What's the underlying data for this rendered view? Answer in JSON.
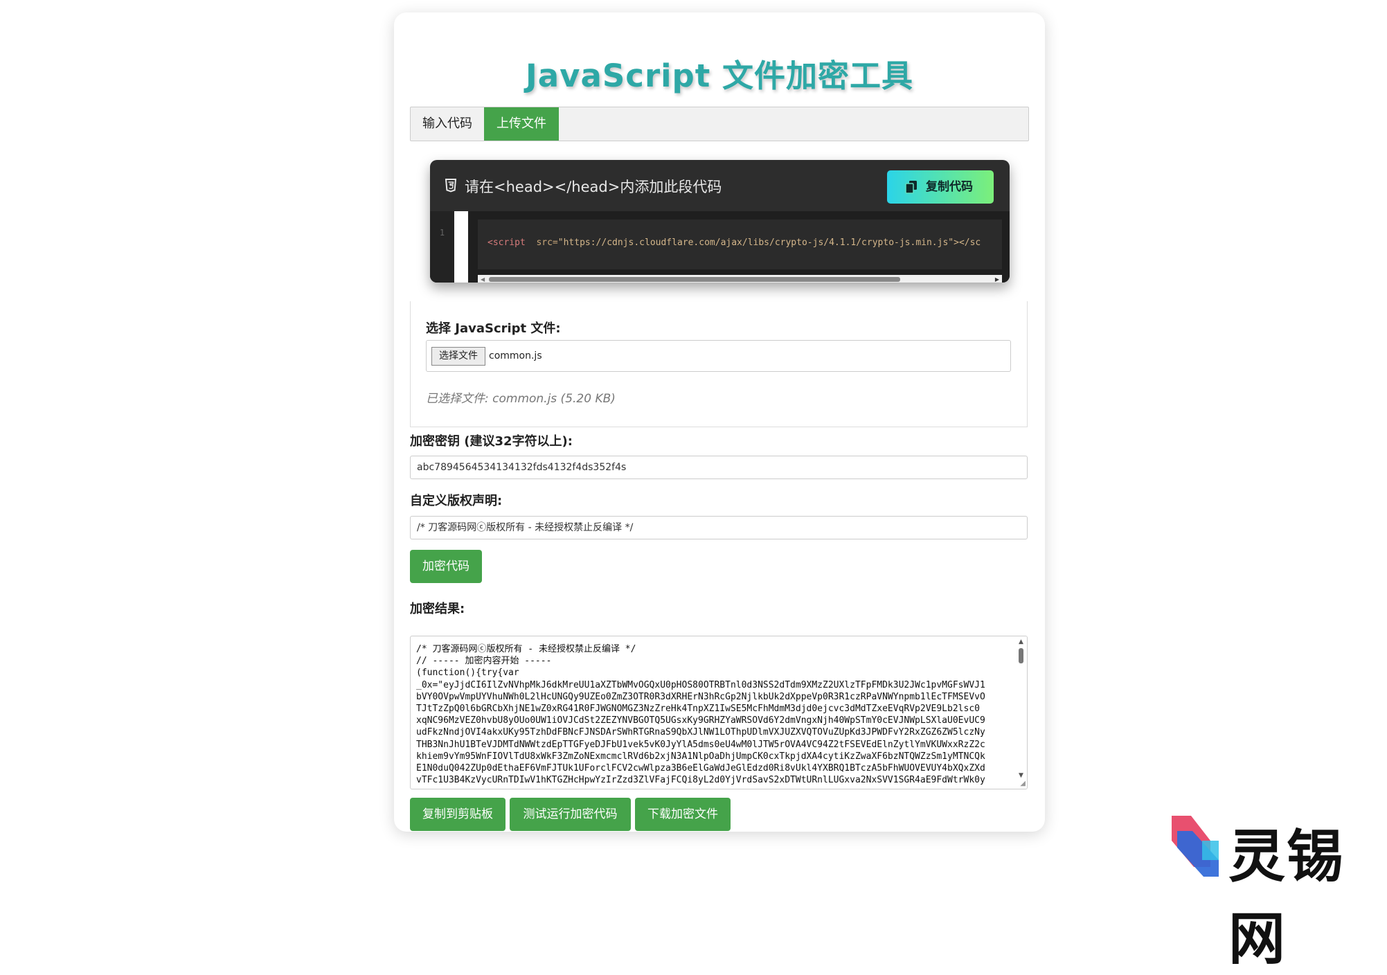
{
  "title": "JavaScript 文件加密工具",
  "tabs": [
    {
      "label": "输入代码",
      "active": false
    },
    {
      "label": "上传文件",
      "active": true
    }
  ],
  "code_panel": {
    "label": "请在<head></head>内添加此段代码",
    "copy_label": "复制代码",
    "line_number": "1",
    "code_tag": "<script",
    "code_attr": "src=",
    "code_value": "\"https://cdnjs.cloudflare.com/ajax/libs/crypto-js/4.1.1/crypto-js.min.js\"></sc"
  },
  "file_section": {
    "label": "选择 JavaScript 文件:",
    "choose_button": "选择文件",
    "file_name": "common.js",
    "selected_info": "已选择文件: common.js (5.20 KB)"
  },
  "key": {
    "label": "加密密钥 (建议32字符以上):",
    "value": "abc7894564534134132fds4132f4ds352f4s"
  },
  "copyright": {
    "label": "自定义版权声明:",
    "value": "/* 刀客源码网ⓒ版权所有 - 未经授权禁止反编译 */"
  },
  "encrypt_button": "加密代码",
  "result": {
    "label": "加密结果:",
    "lines": [
      "/* 刀客源码网ⓒ版权所有 - 未经授权禁止反编译 */",
      "// ----- 加密内容开始 -----",
      "(function(){try{var",
      "_0x=\"eyJjdCI6IlZvNVhpMkJ6dkMreUU1aXZTbWMvOGQxU0pHOS80OTRBTnl0d3NSS2dTdm9XMzZ2UXlzTFpFMDk3U2JWc1pvMGFsWVJ1",
      "bVY0OVpwVmpUYVhuNWh0L2lHcUNGQy9UZEo0ZmZ3OTR0R3dXRHErN3hRcGp2NjlkbUk2dXppeVp0R3R1czRPaVNWYnpmb1lEcTFMSEVvO",
      "TJtTzZpQ0l6bGRCbXhjNE1wZ0xRG41R0FJWGNOMGZ3NzZreHk4TnpXZ1IwSE5McFhMdmM3djd0ejcvc3dMdTZxeEVqRVp2VE9Lb2lsc0",
      "xqNC96MzVEZ0hvbU8yOUo0UW1iOVJCdSt2ZEZYNVBGOTQ5UGsxKy9GRHZYaWRSOVd6Y2dmVngxNjh40WpSTmY0cEVJNWpLSXlaU0EvUC9",
      "udFkzNndjOVI4akxUKy95TzhDdFBNcFJNSDArSWhRTGRnaS9QbXJlNW1LOThpUDlmVXJUZXVQTOVuZUpKd3JPWDFvY2RxZGZ6ZW5lczNy",
      "THB3NnJhU1BTeVJDMTdNWWtzdEpTTGFyeDJFbU1vek5vK0JyYlA5dms0eU4wM0lJTW5rOVA4VC94Z2tFSEVEdElnZytlYmVKUWxxRzZ2c",
      "khiem9vYm95WnFIOVlTdU8xWkF3ZmZoNExmcmclRVd6b2xjN3A1NlpOaDhjUmpCK0cxTkpjdXA4cytiKzZwaXF6bzNTQWZzSm1yMTNCQk",
      "E1N0duQ042ZUp0dEthaEF6VmFJTUk1UForclFCV2cwWlpza3B6eElGaWdJeGlEdzd0Ri8vUkl4YXBRQ1BTczA5bFhWUOVEVUY4bXQxZXd",
      "vTFc1U3B4KzVycURnTDIwV1hKTGZHcHpwYzIrZzd3ZlVFajFCQi8yL2d0YjVrdSavS2xDTWtURnlLUGxva2NxSVV1SGR4aE9FdWtrWk0y"
    ]
  },
  "actions": [
    "复制到剪贴板",
    "测试运行加密代码",
    "下载加密文件"
  ],
  "watermark": "灵锡网",
  "colors": {
    "accent": "#45a34a",
    "title": "#2ea8a6",
    "panel": "#2d2d2d"
  }
}
